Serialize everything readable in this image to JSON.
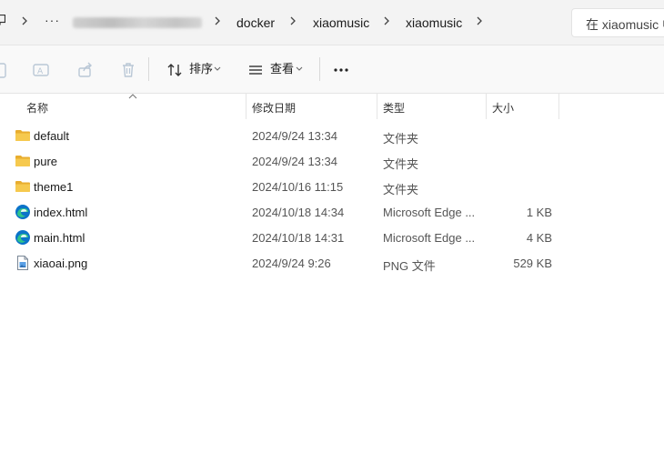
{
  "breadcrumb": {
    "overflow": "···",
    "segments": [
      "docker",
      "xiaomusic",
      "xiaomusic"
    ]
  },
  "search": {
    "placeholder": "在 xiaomusic 中"
  },
  "toolbar": {
    "sort_label": "排序",
    "view_label": "查看",
    "more_label": "···"
  },
  "columns": {
    "name": "名称",
    "date": "修改日期",
    "type": "类型",
    "size": "大小"
  },
  "files": [
    {
      "name": "default",
      "date": "2024/9/24 13:34",
      "type": "文件夹",
      "size": "",
      "icon": "folder-icon"
    },
    {
      "name": "pure",
      "date": "2024/9/24 13:34",
      "type": "文件夹",
      "size": "",
      "icon": "folder-icon"
    },
    {
      "name": "theme1",
      "date": "2024/10/16 11:15",
      "type": "文件夹",
      "size": "",
      "icon": "folder-icon"
    },
    {
      "name": "index.html",
      "date": "2024/10/18 14:34",
      "type": "Microsoft Edge ...",
      "size": "1 KB",
      "icon": "edge-icon"
    },
    {
      "name": "main.html",
      "date": "2024/10/18 14:31",
      "type": "Microsoft Edge ...",
      "size": "4 KB",
      "icon": "edge-icon"
    },
    {
      "name": "xiaoai.png",
      "date": "2024/9/24 9:26",
      "type": "PNG 文件",
      "size": "529 KB",
      "icon": "image-file-icon"
    }
  ],
  "colors": {
    "folder": "#f4c54a",
    "edge_blue": "#0b73c9",
    "edge_green": "#2fc48a"
  }
}
